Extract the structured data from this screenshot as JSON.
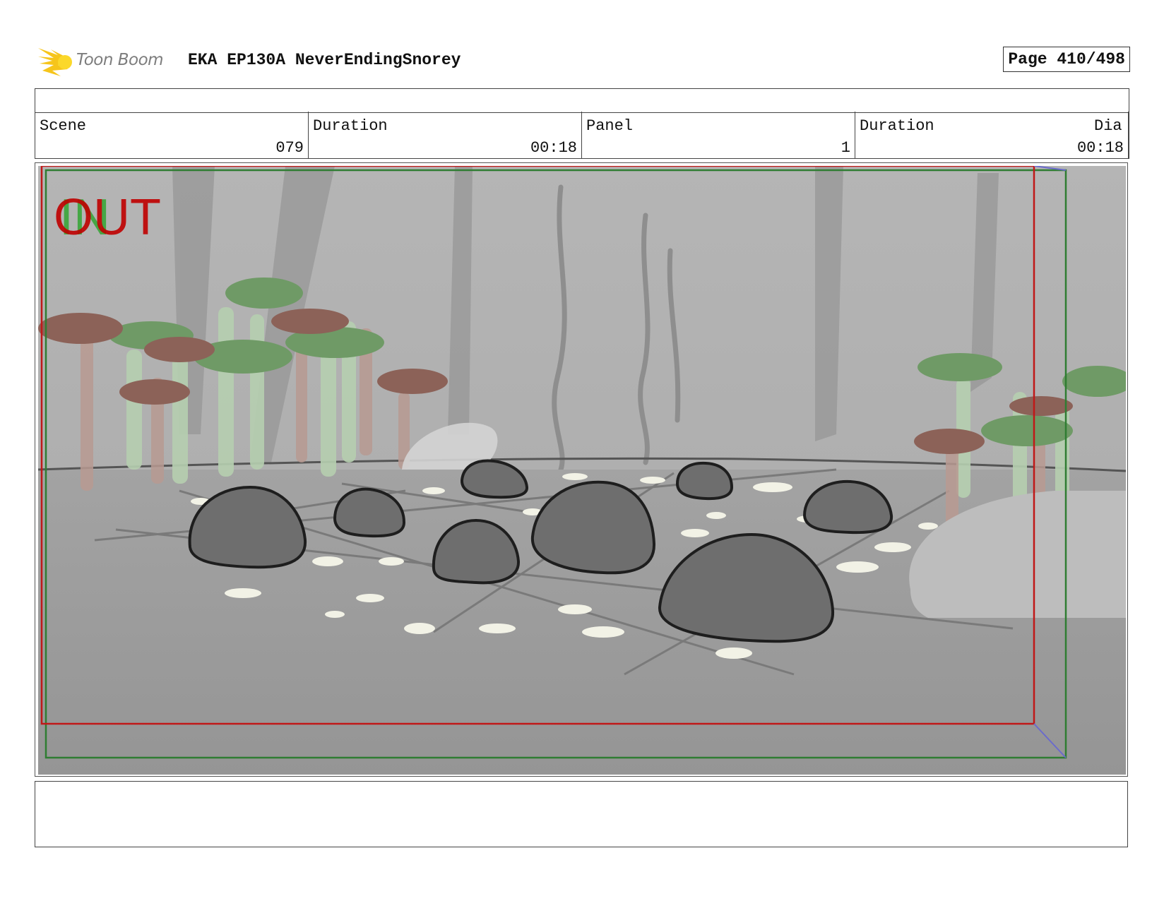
{
  "header": {
    "logo_text": "Toon Boom",
    "title": "EKA EP130A NeverEndingSnorey",
    "page": "Page 410/498"
  },
  "info": {
    "scene_label": "Scene",
    "scene_value": "079",
    "duration_label": "Duration",
    "duration_value": "00:18",
    "panel_label": "Panel",
    "panel_value": "1",
    "panel_duration_label": "Duration",
    "panel_duration_value": "00:18",
    "dialogue_label": "Dia"
  },
  "panel": {
    "in_label": "IN",
    "out_label": "OUT"
  },
  "colors": {
    "in_frame": "#2f7d32",
    "out_frame": "#c01818",
    "ground": "#9d9d9d",
    "bear": "#6e6e6e"
  }
}
